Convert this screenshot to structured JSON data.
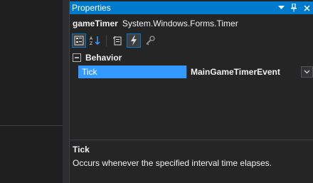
{
  "panel": {
    "title": "Properties",
    "buttons": {
      "dropdown_icon": "chevron-down-icon",
      "pin_icon": "pin-icon",
      "close_icon": "close-icon"
    }
  },
  "object": {
    "name": "gameTimer",
    "type": "System.Windows.Forms.Timer"
  },
  "toolbar": {
    "items": [
      "categorized-icon",
      "alphabetical-icon",
      "properties-icon",
      "events-icon",
      "property-pages-icon"
    ],
    "active": "events-icon"
  },
  "grid": {
    "category": "Behavior",
    "properties": [
      {
        "name": "Tick",
        "value": "MainGameTimerEvent",
        "selected": true
      }
    ]
  },
  "description": {
    "title": "Tick",
    "text": "Occurs whenever the specified interval time elapses."
  },
  "colors": {
    "accent": "#007acc",
    "selection": "#3399ff",
    "background": "#252526"
  }
}
